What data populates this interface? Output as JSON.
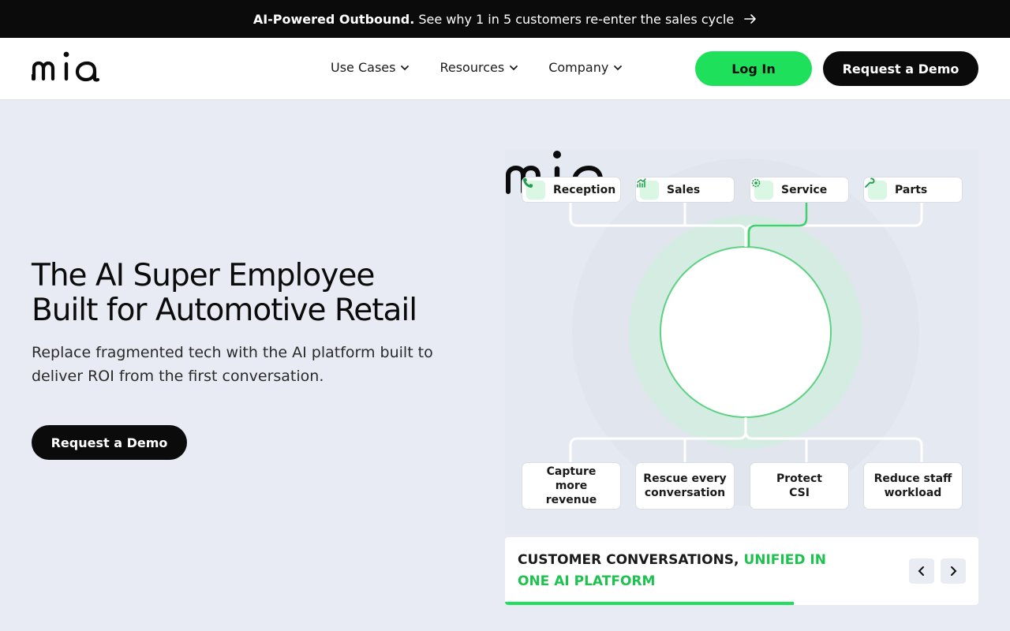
{
  "announcement": {
    "bold": "AI-Powered Outbound.",
    "text": "See why 1 in 5 customers re-enter the sales cycle",
    "icon": "arrow-right-icon"
  },
  "brand": {
    "logo_text": "mia",
    "accent": "#1ee05a",
    "dark": "#0b0b0b"
  },
  "nav": {
    "items": [
      {
        "label": "Use Cases"
      },
      {
        "label": "Resources"
      },
      {
        "label": "Company"
      }
    ]
  },
  "header": {
    "login_label": "Log In",
    "demo_label": "Request a Demo"
  },
  "hero": {
    "title_line1": "The AI Super Employee",
    "title_line2": "Built for Automotive Retail",
    "subtitle": "Replace fragmented tech with the AI platform built to deliver ROI from the first conversation.",
    "cta_label": "Request a Demo"
  },
  "diagram": {
    "departments": [
      {
        "label": "Reception",
        "icon": "phone-icon"
      },
      {
        "label": "Sales",
        "icon": "chart-icon"
      },
      {
        "label": "Service",
        "icon": "gear-icon"
      },
      {
        "label": "Parts",
        "icon": "wrench-icon"
      }
    ],
    "outcomes": [
      {
        "label": "Capture more revenue"
      },
      {
        "label": "Rescue every conversation"
      },
      {
        "label": "Protect CSI"
      },
      {
        "label": "Reduce staff workload"
      }
    ],
    "center_logo_text": "mia"
  },
  "carousel": {
    "caption_main": "CUSTOMER CONVERSATIONS,",
    "caption_accent": "UNIFIED IN ONE AI PLATFORM",
    "progress": 0.61
  }
}
